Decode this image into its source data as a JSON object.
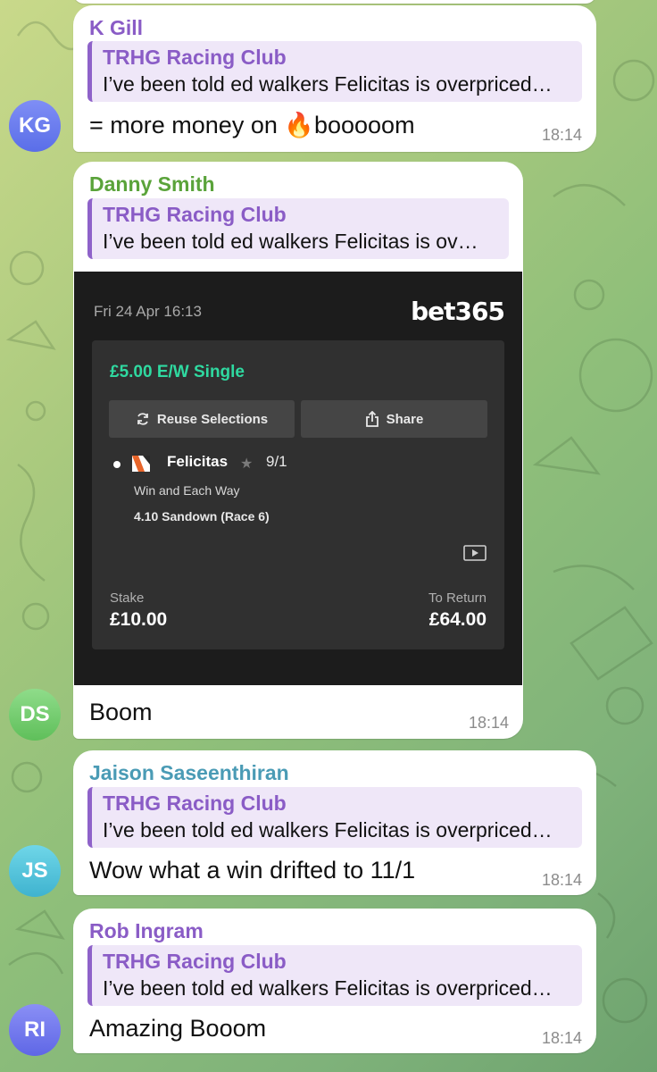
{
  "theme": {
    "reply_accent": "#8e62c9",
    "bet_green": "#2fd9a0"
  },
  "messages": [
    {
      "sender": "K Gill",
      "sender_color": "#8a5cc6",
      "reply_title": "TRHG Racing Club",
      "reply_text": "I’ve been told ed walkers Felicitas is overpriced…",
      "text": "= more money on 🔥booooom",
      "time": "18:14",
      "avatar_initials": "KG",
      "avatar_color": "#6c7ef0"
    },
    {
      "sender": "Danny Smith",
      "sender_color": "#5aa33a",
      "reply_title": "TRHG Racing Club",
      "reply_text": "I’ve been told ed walkers Felicitas is ov…",
      "text": "Boom",
      "time": "18:14",
      "avatar_initials": "DS",
      "avatar_color": "#7fd07a"
    },
    {
      "sender": "Jaison Saseenthiran",
      "sender_color": "#4a9bb5",
      "reply_title": "TRHG Racing Club",
      "reply_text": "I’ve been told ed walkers Felicitas is overpriced…",
      "text": "Wow what a win drifted to 11/1",
      "time": "18:14",
      "avatar_initials": "JS",
      "avatar_color": "#5cc9dd"
    },
    {
      "sender": "Rob Ingram",
      "sender_color": "#8a5cc6",
      "reply_title": "TRHG Racing Club",
      "reply_text": "I’ve been told ed walkers Felicitas is overpriced…",
      "text": "Amazing Booom",
      "time": "18:14",
      "avatar_initials": "RI",
      "avatar_color": "#7a7ff0"
    }
  ],
  "bet_slip": {
    "date": "Fri 24 Apr 16:13",
    "brand": "bet365",
    "bet_type": "£5.00  E/W Single",
    "reuse_label": "Reuse Selections",
    "share_label": "Share",
    "selection_name": "Felicitas",
    "selection_odds": "9/1",
    "market": "Win and Each Way",
    "race": "4.10 Sandown (Race 6)",
    "stake_label": "Stake",
    "stake_value": "£10.00",
    "return_label": "To Return",
    "return_value": "£64.00",
    "icons": [
      "refresh-icon",
      "share-icon",
      "star-icon",
      "video-icon",
      "silks-icon"
    ]
  }
}
